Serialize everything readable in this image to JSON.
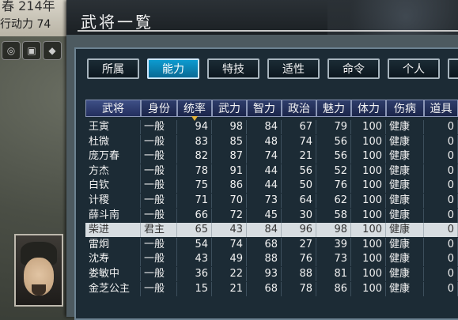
{
  "hud": {
    "line1": "春 214年",
    "line2": "行动力 74"
  },
  "window": {
    "title": "武将一覧",
    "tabs": [
      "所属",
      "能力",
      "特技",
      "适性",
      "命令",
      "个人"
    ],
    "active_tab": 1
  },
  "table": {
    "columns": [
      "武将",
      "身份",
      "统率",
      "武力",
      "智力",
      "政治",
      "魅力",
      "体力",
      "伤病",
      "道具"
    ],
    "sorted_column": 2,
    "rows": [
      [
        "王寅",
        "一般",
        "94",
        "98",
        "84",
        "67",
        "79",
        "100",
        "健康",
        "0"
      ],
      [
        "杜微",
        "一般",
        "83",
        "85",
        "48",
        "74",
        "56",
        "100",
        "健康",
        "0"
      ],
      [
        "庞万春",
        "一般",
        "82",
        "87",
        "74",
        "21",
        "56",
        "100",
        "健康",
        "0"
      ],
      [
        "方杰",
        "一般",
        "78",
        "91",
        "44",
        "56",
        "52",
        "100",
        "健康",
        "0"
      ],
      [
        "白钦",
        "一般",
        "75",
        "86",
        "44",
        "50",
        "76",
        "100",
        "健康",
        "0"
      ],
      [
        "计稷",
        "一般",
        "71",
        "70",
        "73",
        "64",
        "62",
        "100",
        "健康",
        "0"
      ],
      [
        "薛斗南",
        "一般",
        "66",
        "72",
        "45",
        "30",
        "58",
        "100",
        "健康",
        "0"
      ],
      [
        "柴进",
        "君主",
        "65",
        "43",
        "84",
        "96",
        "98",
        "100",
        "健康",
        "0"
      ],
      [
        "雷炯",
        "一般",
        "54",
        "74",
        "68",
        "27",
        "39",
        "100",
        "健康",
        "0"
      ],
      [
        "沈寿",
        "一般",
        "43",
        "49",
        "88",
        "76",
        "73",
        "100",
        "健康",
        "0"
      ],
      [
        "娄敏中",
        "一般",
        "36",
        "22",
        "93",
        "88",
        "81",
        "100",
        "健康",
        "0"
      ],
      [
        "金芝公主",
        "一般",
        "15",
        "21",
        "68",
        "78",
        "86",
        "100",
        "健康",
        "0"
      ]
    ],
    "selected_row": 7
  },
  "colors": {
    "active_tab": "#0c9bd0",
    "header": "#2e3d6b",
    "panel": "#1c2b35",
    "selected_row": "#d7dde1"
  }
}
